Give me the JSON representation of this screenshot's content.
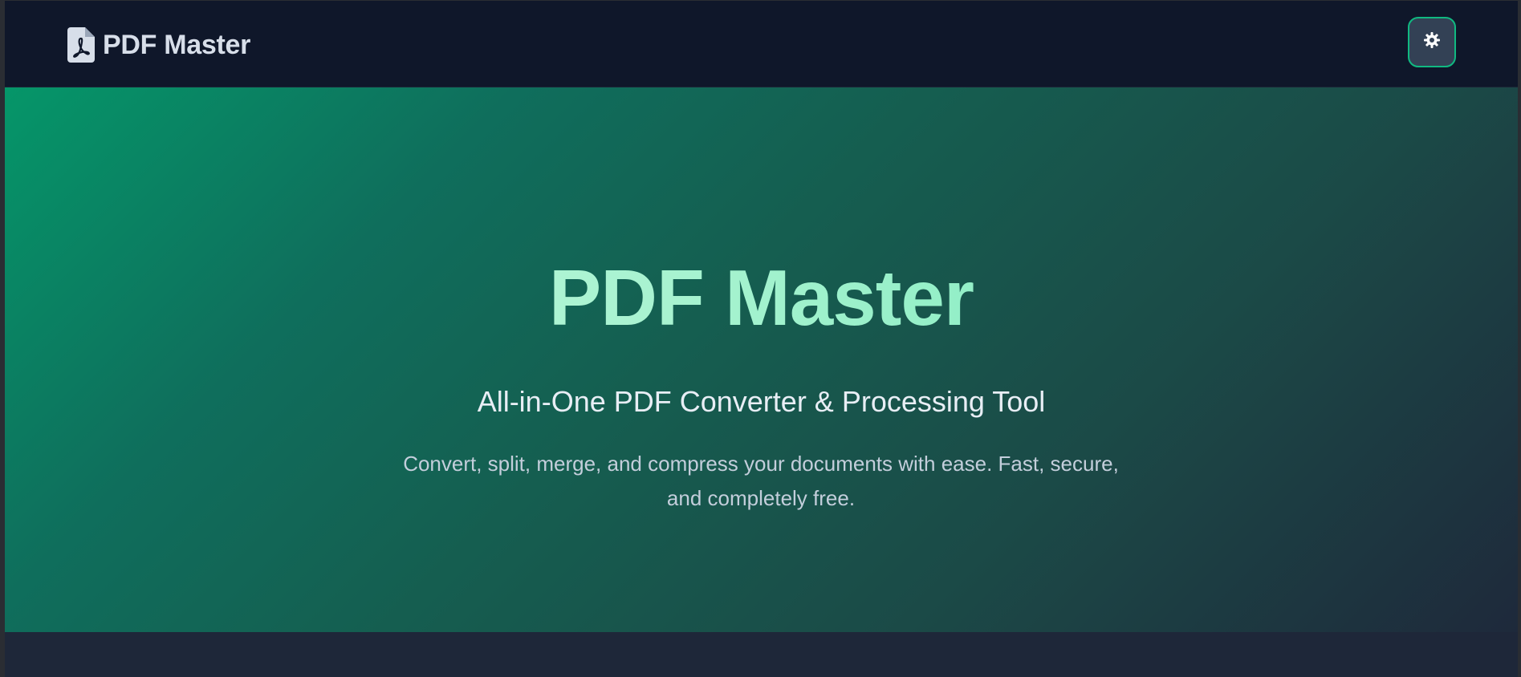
{
  "navbar": {
    "brand_name": "PDF Master",
    "brand_icon": "pdf-file-icon",
    "theme_toggle_icon": "gear-icon"
  },
  "hero": {
    "title": "PDF Master",
    "subtitle": "All-in-One PDF Converter & Processing Tool",
    "description": "Convert, split, merge, and compress your documents with ease. Fast, secure, and completely free."
  },
  "colors": {
    "accent": "#10b981",
    "navbar_bg": "#0f172a",
    "page_bg": "#1e293b",
    "hero_gradient_start": "#059669",
    "hero_gradient_end": "#1e293b",
    "title_gradient": [
      "#c6f6df",
      "#6ee7b7"
    ]
  }
}
